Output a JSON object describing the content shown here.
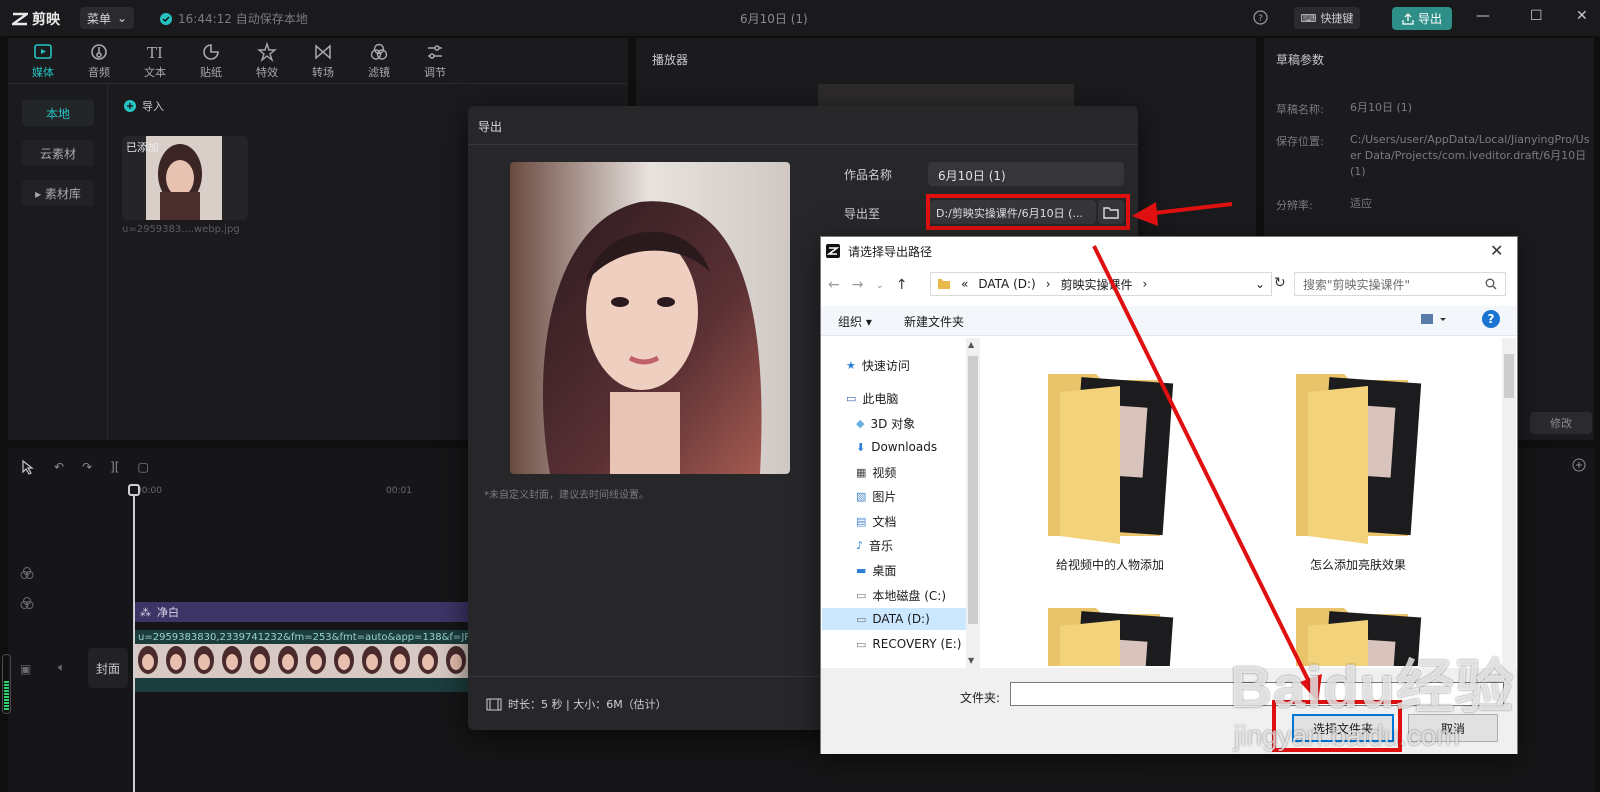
{
  "titlebar": {
    "app_name": "剪映",
    "menu_label": "菜单",
    "autosave": "16:44:12 自动保存本地",
    "doc_title": "6月10日 (1)",
    "shortcut_label": "快捷键",
    "export_label": "导出"
  },
  "toolbar": {
    "items": [
      {
        "label": "媒体",
        "icon": "media-icon"
      },
      {
        "label": "音频",
        "icon": "audio-icon"
      },
      {
        "label": "文本",
        "icon": "text-icon"
      },
      {
        "label": "贴纸",
        "icon": "sticker-icon"
      },
      {
        "label": "特效",
        "icon": "effects-icon"
      },
      {
        "label": "转场",
        "icon": "transition-icon"
      },
      {
        "label": "滤镜",
        "icon": "filter-icon"
      },
      {
        "label": "调节",
        "icon": "adjust-icon"
      }
    ]
  },
  "media": {
    "side": [
      "本地",
      "云素材",
      "▸ 素材库"
    ],
    "import_label": "导入",
    "thumb_badge": "已添加",
    "thumb_name": "u=2959383....webp.jpg"
  },
  "player": {
    "title": "播放器"
  },
  "params": {
    "title": "草稿参数",
    "name_label": "草稿名称:",
    "name_value": "6月10日 (1)",
    "location_label": "保存位置:",
    "location_value": "C:/Users/user/AppData/Local/JianyingPro/User Data/Projects/com.lveditor.draft/6月10日 (1)",
    "resolution_label": "分辨率:",
    "resolution_value": "适应",
    "modify_label": "修改"
  },
  "timeline": {
    "ruler_start": "00:00",
    "ruler_mid": "00:01",
    "track_clean": "净白",
    "video_clip": "u=2959383830,2339741232&fm=253&fmt=auto&app=138&f=JP",
    "cover_label": "封面"
  },
  "export_dialog": {
    "title": "导出",
    "cover_hint": "*未自定义封面，建议去时间线设置。",
    "name_label": "作品名称",
    "name_value": "6月10日 (1)",
    "path_label": "导出至",
    "path_value": "D:/剪映实操课件/6月10日 (...",
    "info": "时长：5 秒 | 大小：6M（估计）"
  },
  "file_dialog": {
    "title": "请选择导出路径",
    "address": [
      "«",
      "DATA (D:)",
      "›",
      "剪映实操课件",
      "›"
    ],
    "search_placeholder": "搜索\"剪映实操课件\"",
    "organize": "组织 ▾",
    "new_folder": "新建文件夹",
    "help": "?",
    "tree": [
      {
        "label": "快速访问",
        "icon": "star-icon"
      },
      {
        "label": "此电脑",
        "icon": "computer-icon"
      },
      {
        "label": "3D 对象",
        "icon": "cube-icon"
      },
      {
        "label": "Downloads",
        "icon": "download-icon"
      },
      {
        "label": "视频",
        "icon": "video-icon"
      },
      {
        "label": "图片",
        "icon": "image-icon"
      },
      {
        "label": "文档",
        "icon": "document-icon"
      },
      {
        "label": "音乐",
        "icon": "music-icon"
      },
      {
        "label": "桌面",
        "icon": "desktop-icon"
      },
      {
        "label": "本地磁盘 (C:)",
        "icon": "drive-icon"
      },
      {
        "label": "DATA (D:)",
        "icon": "drive-icon"
      },
      {
        "label": "RECOVERY (E:)",
        "icon": "drive-icon"
      }
    ],
    "folders": [
      "给视频中的人物添加",
      "怎么添加亮肤效果",
      "",
      ""
    ],
    "folder_field_label": "文件夹:",
    "select_btn": "选择文件夹",
    "cancel_btn": "取消"
  },
  "watermark": {
    "line1": "Baidu经验",
    "line2": "jingyan.baidu.com"
  },
  "colors": {
    "accent": "#25c4c2",
    "export_btn": "#2d8f88",
    "annotation": "#e01010",
    "win_blue": "#0078d7"
  }
}
